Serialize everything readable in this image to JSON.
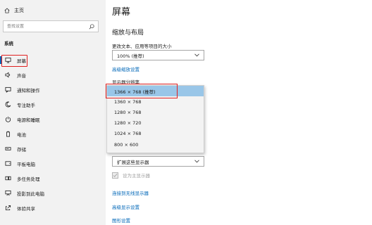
{
  "sidebar": {
    "home_label": "主页",
    "search_placeholder": "查找设置",
    "section_title": "系统",
    "items": [
      {
        "label": "屏幕",
        "icon": "monitor-icon"
      },
      {
        "label": "声音",
        "icon": "speaker-icon"
      },
      {
        "label": "通知和操作",
        "icon": "message-icon"
      },
      {
        "label": "专注助手",
        "icon": "moon-icon"
      },
      {
        "label": "电源和睡眠",
        "icon": "power-icon"
      },
      {
        "label": "电池",
        "icon": "battery-icon"
      },
      {
        "label": "存储",
        "icon": "storage-icon"
      },
      {
        "label": "平板电脑",
        "icon": "tablet-icon"
      },
      {
        "label": "多任务处理",
        "icon": "multitask-icon"
      },
      {
        "label": "投影到此电脑",
        "icon": "projector-icon"
      },
      {
        "label": "体验共享",
        "icon": "share-icon"
      }
    ]
  },
  "main": {
    "title": "屏幕",
    "scale_section_title": "缩放与布局",
    "scale_label": "更改文本、应用等项目的大小",
    "scale_value": "100% (推荐)",
    "advanced_scaling_link": "高级缩放设置",
    "resolution_label": "显示器分辨率",
    "resolution_options": [
      "1366 × 768 (推荐)",
      "1360 × 768",
      "1280 × 768",
      "1280 × 720",
      "1024 × 768",
      "800 × 600"
    ],
    "multi_display_value": "扩展这些显示器",
    "main_display_checkbox": "设为主显示器",
    "wireless_link": "连接到无线显示器",
    "advanced_display_link": "高级显示设置",
    "graphics_link": "图形设置"
  },
  "colors": {
    "accent": "#0067b8",
    "selection": "#99c6e8",
    "highlight_outline": "#e02020"
  }
}
